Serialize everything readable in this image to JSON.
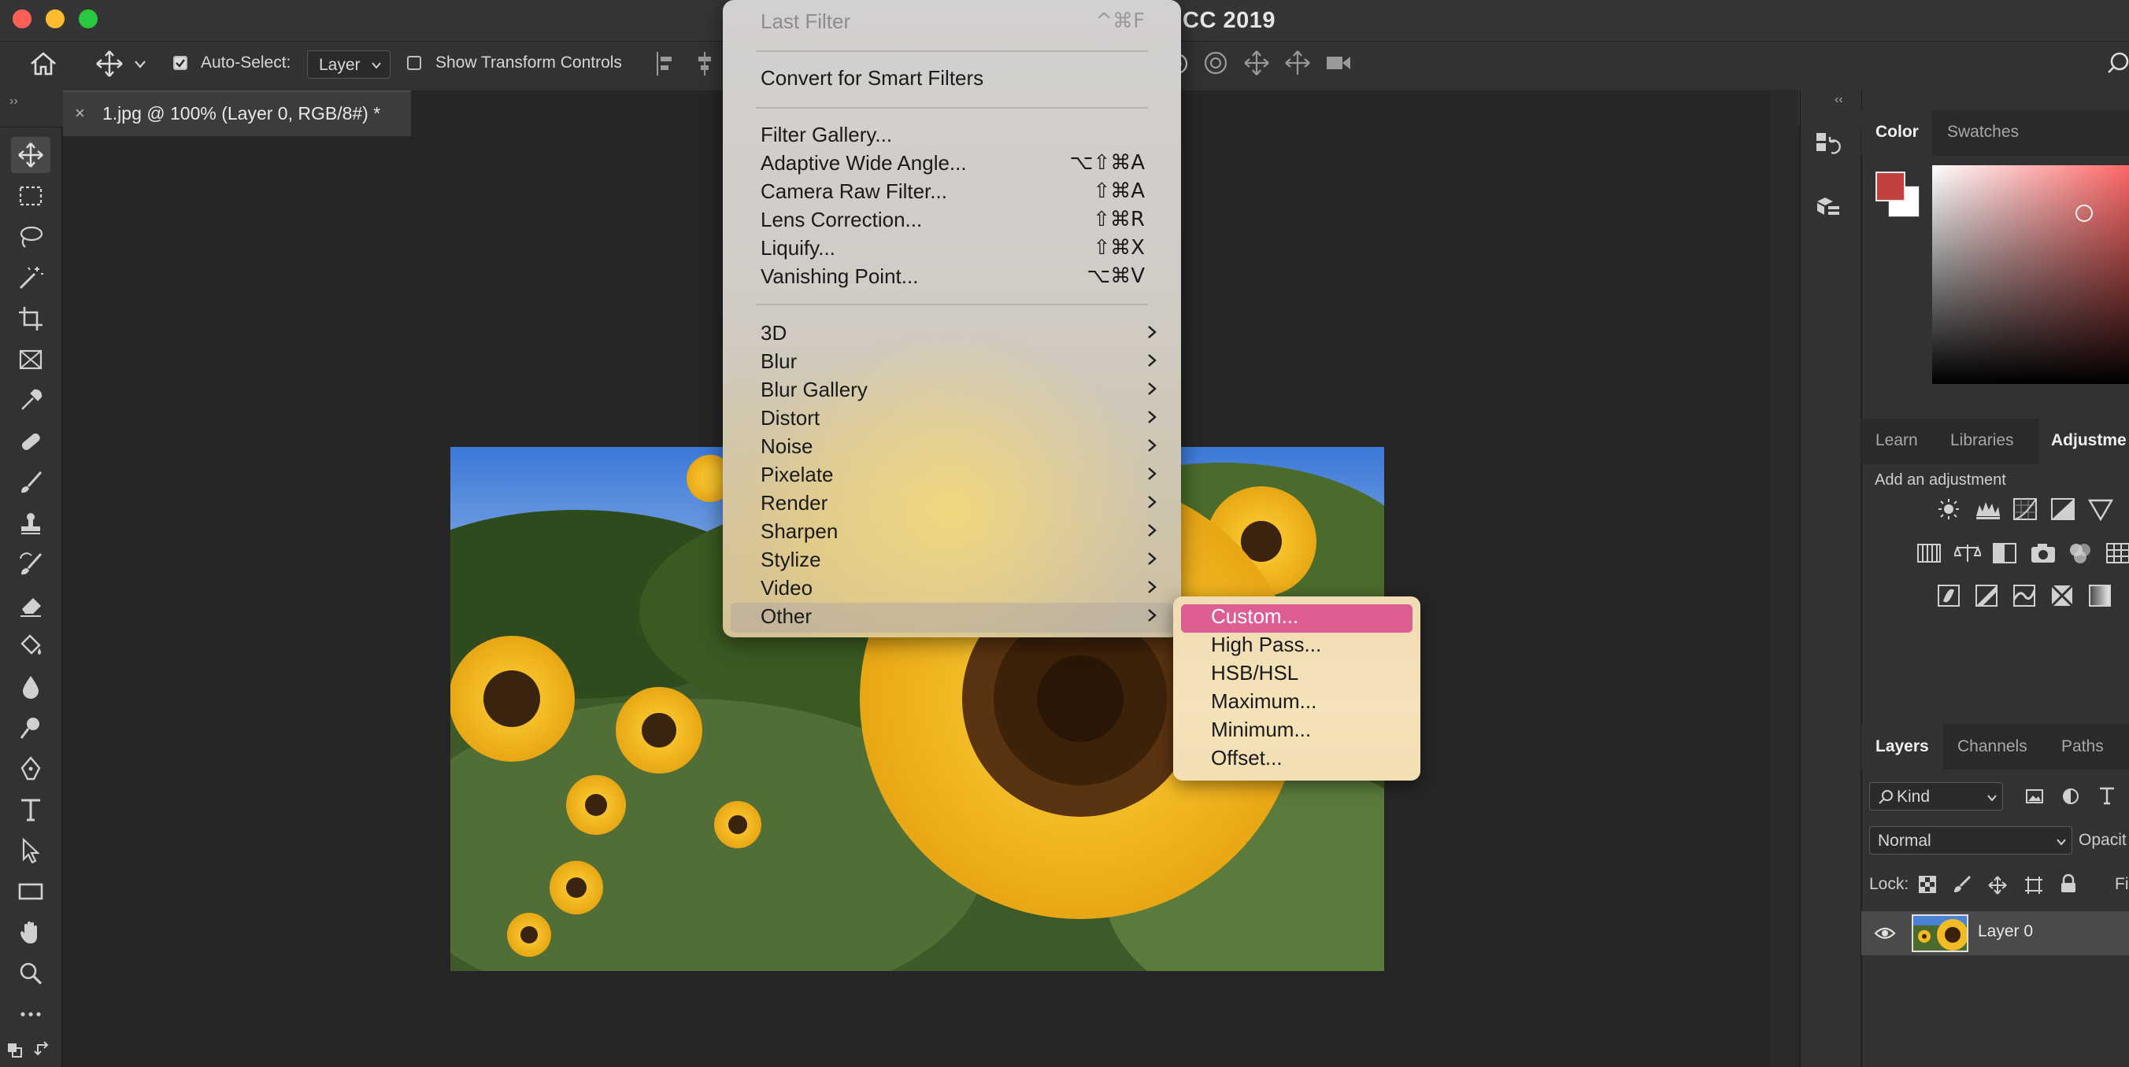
{
  "window": {
    "title": "CC 2019"
  },
  "options_bar": {
    "auto_select_label": "Auto-Select:",
    "auto_select_value": "Layer",
    "show_transform_label": "Show Transform Controls"
  },
  "document_tab": {
    "label": "1.jpg @ 100% (Layer 0, RGB/8#) *",
    "close": "×"
  },
  "filter_menu": {
    "items": [
      {
        "label": "Last Filter",
        "shortcut": "^⌘F",
        "disabled": true
      },
      {
        "label": "Convert for Smart Filters"
      },
      {
        "label": "Filter Gallery..."
      },
      {
        "label": "Adaptive Wide Angle...",
        "shortcut": "⌥⇧⌘A"
      },
      {
        "label": "Camera Raw Filter...",
        "shortcut": "⇧⌘A"
      },
      {
        "label": "Lens Correction...",
        "shortcut": "⇧⌘R"
      },
      {
        "label": "Liquify...",
        "shortcut": "⇧⌘X"
      },
      {
        "label": "Vanishing Point...",
        "shortcut": "⌥⌘V"
      },
      {
        "label": "3D"
      },
      {
        "label": "Blur"
      },
      {
        "label": "Blur Gallery"
      },
      {
        "label": "Distort"
      },
      {
        "label": "Noise"
      },
      {
        "label": "Pixelate"
      },
      {
        "label": "Render"
      },
      {
        "label": "Sharpen"
      },
      {
        "label": "Stylize"
      },
      {
        "label": "Video"
      },
      {
        "label": "Other"
      }
    ]
  },
  "other_submenu": {
    "items": [
      "Custom...",
      "High Pass...",
      "HSB/HSL",
      "Maximum...",
      "Minimum...",
      "Offset..."
    ],
    "selected": "Custom..."
  },
  "color_panel": {
    "tabs": [
      "Color",
      "Swatches"
    ],
    "foreground": "#c0413d",
    "background": "#ffffff"
  },
  "adjust_panel": {
    "tabs": [
      "Learn",
      "Libraries",
      "Adjustme"
    ],
    "hint": "Add an adjustment"
  },
  "layers_panel": {
    "tabs": [
      "Layers",
      "Channels",
      "Paths"
    ],
    "kind_label": "Kind",
    "blend_mode": "Normal",
    "opacity_label": "Opacit",
    "lock_label": "Lock:",
    "fill_label": "Fi",
    "layer_name": "Layer 0"
  },
  "colors": {
    "menu_highlight": "#dc5e93",
    "ui_dark": "#323232"
  }
}
